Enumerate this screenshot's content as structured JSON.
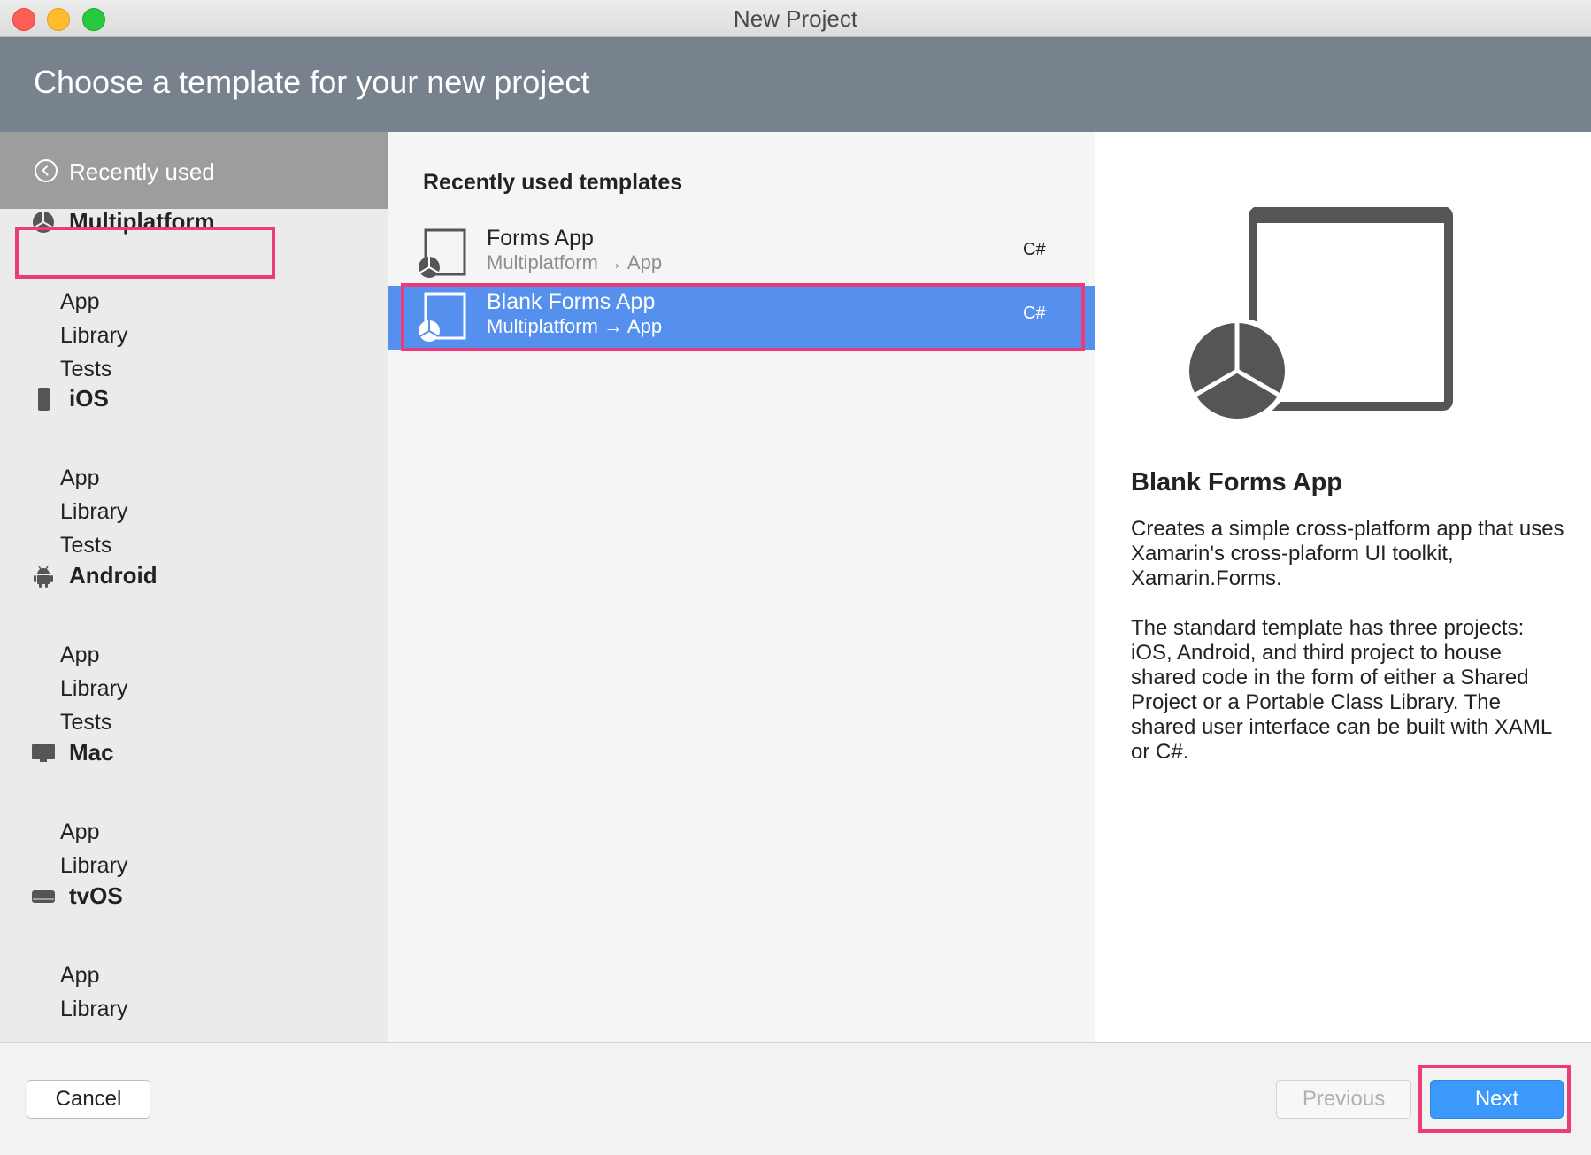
{
  "window": {
    "title": "New Project"
  },
  "header": {
    "title": "Choose a template for your new project"
  },
  "sidebar": {
    "recent_label": "Recently used",
    "categories": [
      {
        "label": "Multiplatform",
        "icon": "pie-chart-icon",
        "items": [
          "App",
          "Library",
          "Tests"
        ]
      },
      {
        "label": "iOS",
        "icon": "phone-icon",
        "items": [
          "App",
          "Library",
          "Tests"
        ]
      },
      {
        "label": "Android",
        "icon": "android-icon",
        "items": [
          "App",
          "Library",
          "Tests"
        ]
      },
      {
        "label": "Mac",
        "icon": "monitor-icon",
        "items": [
          "App",
          "Library"
        ]
      },
      {
        "label": "tvOS",
        "icon": "tv-box-icon",
        "items": [
          "App",
          "Library"
        ]
      }
    ]
  },
  "templates": {
    "heading": "Recently used templates",
    "items": [
      {
        "title": "Forms App",
        "subtitle": "Multiplatform → App",
        "lang": "C#",
        "selected": false
      },
      {
        "title": "Blank Forms App",
        "subtitle": "Multiplatform → App",
        "lang": "C#",
        "selected": true
      }
    ]
  },
  "detail": {
    "title": "Blank Forms App",
    "description": [
      "Creates a simple cross-platform app that uses Xamarin's cross-plaform UI toolkit, Xamarin.Forms.",
      "The standard template has three projects: iOS, Android, and third project to house shared code in the form of either a Shared Project or a Portable Class Library. The shared user interface can be built with XAML or C#."
    ]
  },
  "footer": {
    "cancel_label": "Cancel",
    "previous_label": "Previous",
    "next_label": "Next"
  },
  "colors": {
    "header_bg": "#78828d",
    "selection": "#5690ef",
    "accent_button": "#3b99fc",
    "annotation_highlight": "#ea3c7c"
  }
}
